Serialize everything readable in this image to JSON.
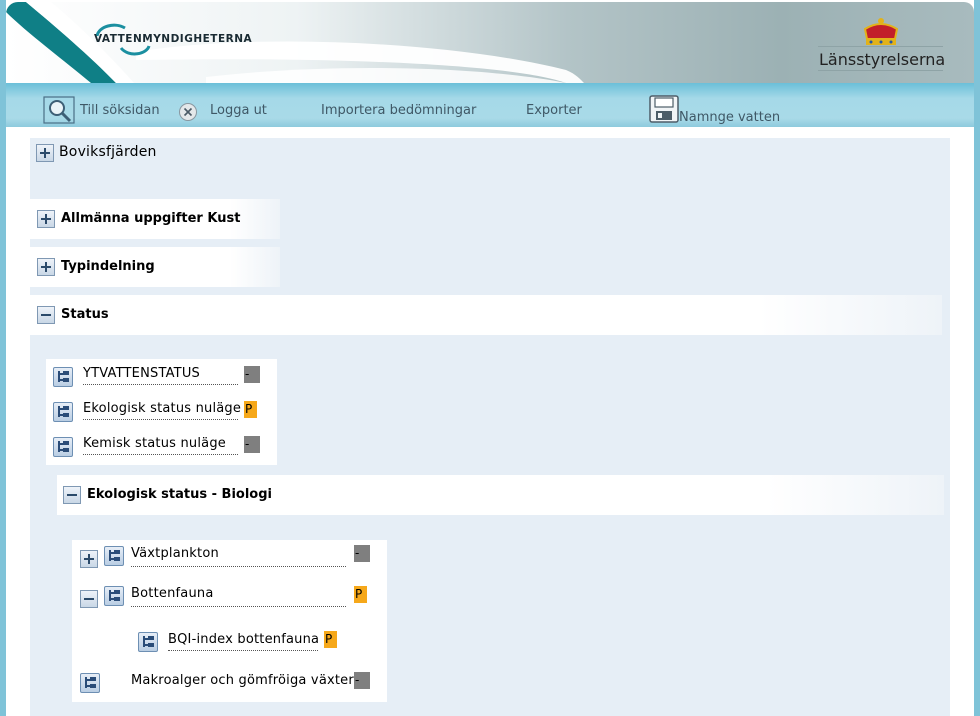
{
  "header": {
    "brand": "VATTENMYNDIGHETERNA",
    "partner": "Länsstyrelserna"
  },
  "toolbar": {
    "search": "Till söksidan",
    "logout": "Logga ut",
    "import": "Importera bedömningar",
    "export": "Exporter",
    "name_water": "Namnge vatten"
  },
  "content": {
    "water_name": "Boviksfjärden",
    "sections": {
      "general": "Allmänna uppgifter Kust",
      "type": "Typindelning",
      "status": "Status",
      "eco_bio": "Ekologisk status - Biologi"
    },
    "status_rows": [
      {
        "label": "YTVATTENSTATUS",
        "value": "-"
      },
      {
        "label": "Ekologisk status nuläge",
        "value": "P"
      },
      {
        "label": "Kemisk status nuläge",
        "value": "-"
      }
    ],
    "bio_rows": [
      {
        "label": "Växtplankton",
        "value": "-"
      },
      {
        "label": "Bottenfauna",
        "value": "P"
      },
      {
        "label": "BQI-index bottenfauna",
        "value": "P"
      },
      {
        "label": "Makroalger och gömfröiga växter",
        "value": "-"
      }
    ]
  },
  "colors": {
    "toolbar": "#a5d9e8",
    "content_bg": "#e6eef6",
    "value_gray": "#7f7f7f",
    "value_orange": "#f6a81a"
  }
}
